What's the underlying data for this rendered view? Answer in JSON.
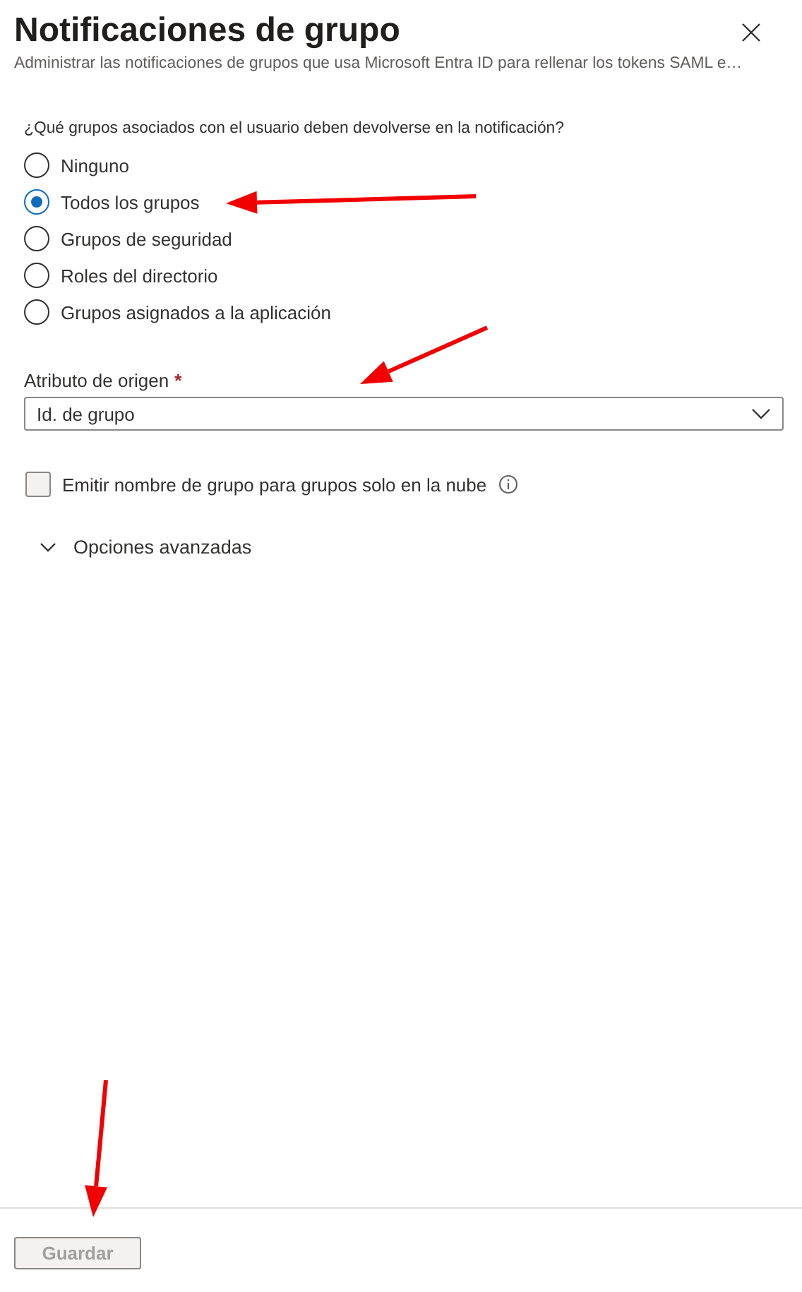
{
  "panel": {
    "title": "Notificaciones de grupo",
    "subtitle": "Administrar las notificaciones de grupos que usa Microsoft Entra ID para rellenar los tokens SAML e…"
  },
  "question": "¿Qué grupos asociados con el usuario deben devolverse en la notificación?",
  "options": [
    {
      "label": "Ninguno",
      "selected": false
    },
    {
      "label": "Todos los grupos",
      "selected": true
    },
    {
      "label": "Grupos de seguridad",
      "selected": false
    },
    {
      "label": "Roles del directorio",
      "selected": false
    },
    {
      "label": "Grupos asignados a la aplicación",
      "selected": false
    }
  ],
  "source_attribute": {
    "label": "Atributo de origen",
    "required": true,
    "required_mark": "*",
    "value": "Id. de grupo"
  },
  "cloud_only_checkbox": {
    "label": "Emitir nombre de grupo para grupos solo en la nube",
    "checked": false
  },
  "advanced": {
    "label": "Opciones avanzadas",
    "expanded": false
  },
  "footer": {
    "save_button": {
      "label": "Guardar",
      "disabled": true
    }
  }
}
